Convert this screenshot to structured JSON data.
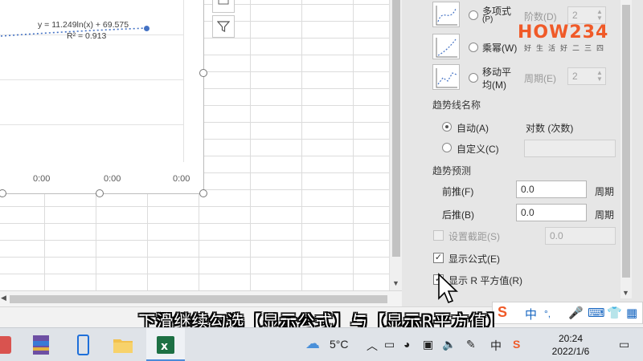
{
  "chart": {
    "equation": "y = 11.249ln(x) + 69.575",
    "r_squared": "R² = 0.913",
    "x_ticks": [
      "0:00",
      "0:00",
      "0:00"
    ]
  },
  "pane": {
    "options": [
      {
        "label_top": "多项式",
        "label_bottom": "(P)",
        "param_label": "阶数(D)",
        "param_value": "2"
      },
      {
        "label": "乘幂(W)"
      },
      {
        "label_top": "移动平",
        "label_bottom": "均(M)",
        "param_label": "周期(E)",
        "param_value": "2"
      }
    ],
    "trendline_name_header": "趋势线名称",
    "auto_label": "自动(A)",
    "auto_value": "对数 (次数)",
    "custom_label": "自定义(C)",
    "forecast_header": "趋势预测",
    "forward_label": "前推(F)",
    "forward_value": "0.0",
    "forward_unit": "周期",
    "backward_label": "后推(B)",
    "backward_value": "0.0",
    "backward_unit": "周期",
    "intercept_label": "设置截距(S)",
    "intercept_value": "0.0",
    "show_equation_label": "显示公式(E)",
    "show_r2_label": "显示 R 平方值(R)"
  },
  "logo": {
    "text": "HOW234",
    "tagline": "好生活好二三四"
  },
  "subtitle": "下滑继续勾选【显示公式】与【显示R平方值】",
  "ime": {
    "lang": "中",
    "punct": "°,"
  },
  "taskbar": {
    "weather": "5°C",
    "ime_lang": "中",
    "time": "20:24",
    "date": "2022/1/6"
  },
  "colors": {
    "accent": "#4472c4",
    "brand": "#f05a28",
    "taskbar": "#dfe3e8"
  }
}
